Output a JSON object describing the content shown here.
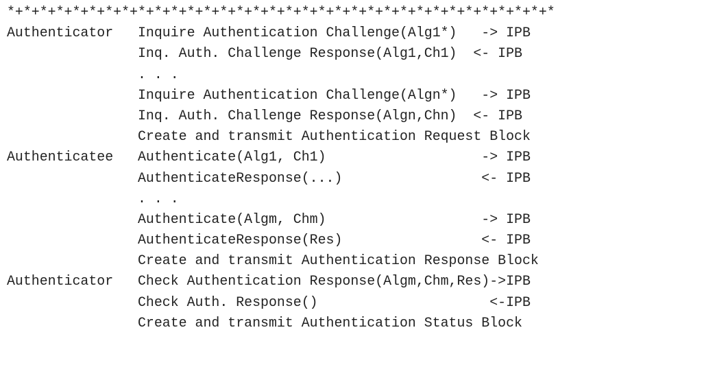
{
  "document": {
    "lines": [
      "*+*+*+*+*+*+*+*+*+*+*+*+*+*+*+*+*+*+*+*+*+*+*+*+*+*+*+*+*+*+*+*+*+*",
      "Authenticator   Inquire Authentication Challenge(Alg1*)   -> IPB",
      "                Inq. Auth. Challenge Response(Alg1,Ch1)  <- IPB",
      "                . . .",
      "                Inquire Authentication Challenge(Algn*)   -> IPB",
      "                Inq. Auth. Challenge Response(Algn,Chn)  <- IPB",
      "                Create and transmit Authentication Request Block",
      "Authenticatee   Authenticate(Alg1, Ch1)                   -> IPB",
      "                AuthenticateResponse(...)                 <- IPB",
      "                . . .",
      "                Authenticate(Algm, Chm)                   -> IPB",
      "                AuthenticateResponse(Res)                 <- IPB",
      "                Create and transmit Authentication Response Block",
      "Authenticator   Check Authentication Response(Algm,Chm,Res)->IPB",
      "                Check Auth. Response()                     <-IPB",
      "                Create and transmit Authentication Status Block"
    ]
  }
}
